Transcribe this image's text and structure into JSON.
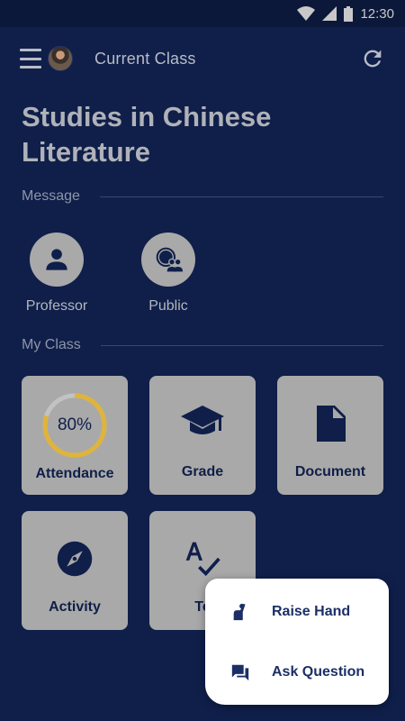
{
  "status": {
    "time": "12:30"
  },
  "header": {
    "title": "Current Class"
  },
  "page": {
    "title_line1": "Studies in Chinese",
    "title_line2": "Literature"
  },
  "message_section": {
    "heading": "Message",
    "items": [
      {
        "label": "Professor",
        "icon": "person-icon"
      },
      {
        "label": "Public",
        "icon": "group-icon"
      }
    ]
  },
  "class_section": {
    "heading": "My Class",
    "tiles": [
      {
        "label": "Attendance",
        "icon": "progress-ring",
        "percent_text": "80%",
        "percent": 80
      },
      {
        "label": "Grade",
        "icon": "graduation-cap-icon"
      },
      {
        "label": "Document",
        "icon": "document-icon"
      },
      {
        "label": "Activity",
        "icon": "compass-icon"
      },
      {
        "label": "Te",
        "icon": "spellcheck-icon"
      }
    ]
  },
  "popup": {
    "items": [
      {
        "label": "Raise Hand",
        "icon": "raise-hand-icon"
      },
      {
        "label": "Ask Question",
        "icon": "chat-icon"
      }
    ]
  },
  "colors": {
    "background": "#0f1f4a",
    "accent": "#e0b43a",
    "tile": "#a9a9a9",
    "text_dark": "#0f1f4a"
  }
}
